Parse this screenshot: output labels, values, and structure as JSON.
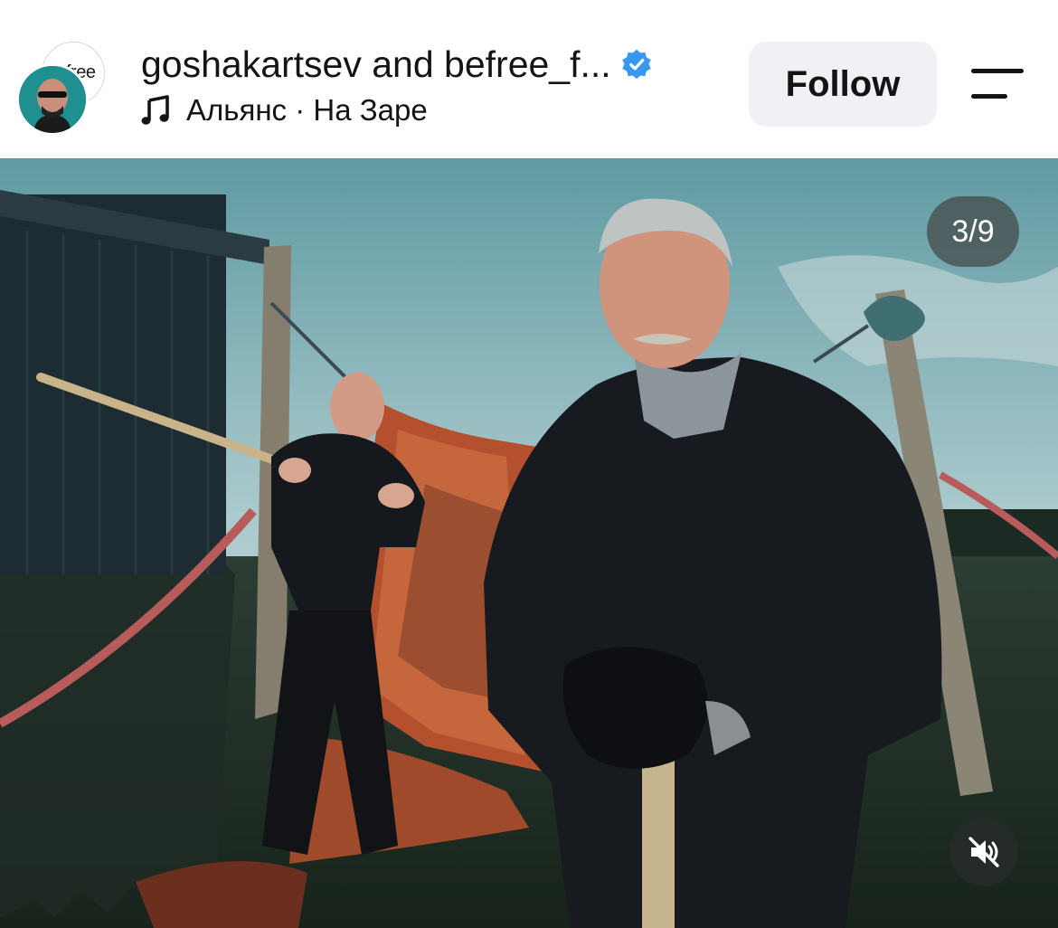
{
  "post_header": {
    "title": "goshakartsev and befree_f...",
    "verified_icon": "verified-badge-icon",
    "audio": {
      "icon": "music-note-icon",
      "track": "Альянс · На Заре"
    },
    "avatar_back_text": "free",
    "follow_label": "Follow",
    "menu_icon": "menu-icon"
  },
  "media": {
    "counter": "3/9",
    "mute_icon": "muted-speaker-icon"
  },
  "colors": {
    "verified_blue": "#3897f0",
    "follow_bg": "#eff1f4",
    "text": "#141414"
  }
}
